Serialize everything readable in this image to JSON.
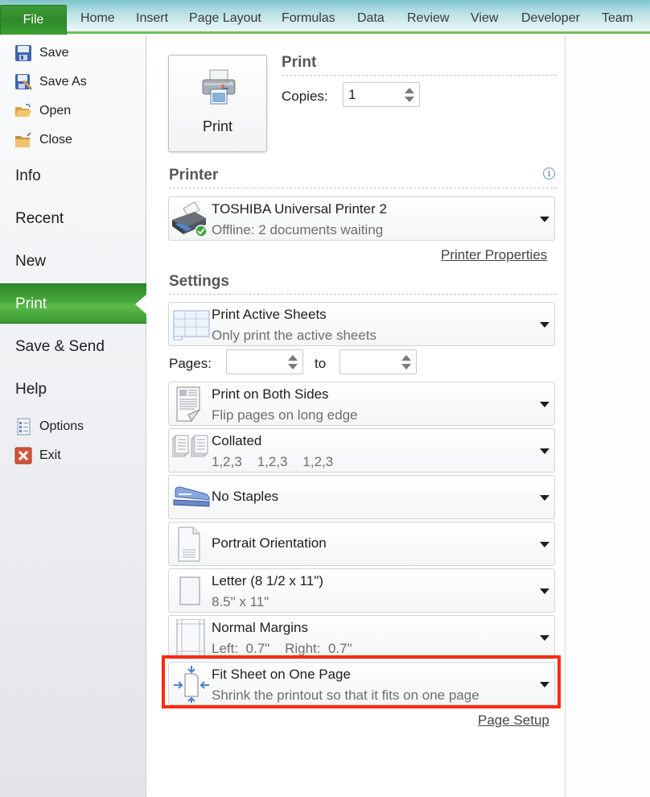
{
  "ribbon": {
    "file_tab": "File",
    "tabs": [
      "Home",
      "Insert",
      "Page Layout",
      "Formulas",
      "Data",
      "Review",
      "View",
      "Developer",
      "Team"
    ]
  },
  "sidebar": {
    "small_items_top": [
      {
        "label": "Save",
        "icon": "save-icon"
      },
      {
        "label": "Save As",
        "icon": "save-as-icon"
      },
      {
        "label": "Open",
        "icon": "open-folder-icon"
      },
      {
        "label": "Close",
        "icon": "close-folder-icon"
      }
    ],
    "big_items": [
      {
        "label": "Info",
        "active": false
      },
      {
        "label": "Recent",
        "active": false
      },
      {
        "label": "New",
        "active": false
      },
      {
        "label": "Print",
        "active": true
      },
      {
        "label": "Save & Send",
        "active": false
      },
      {
        "label": "Help",
        "active": false
      }
    ],
    "small_items_bottom": [
      {
        "label": "Options",
        "icon": "options-icon"
      },
      {
        "label": "Exit",
        "icon": "exit-icon"
      }
    ]
  },
  "print": {
    "button_label": "Print",
    "section_title": "Print",
    "copies_label": "Copies:",
    "copies_value": "1"
  },
  "printer": {
    "section_title": "Printer",
    "name": "TOSHIBA Universal Printer 2",
    "status": "Offline: 2 documents waiting",
    "properties_link": "Printer Properties"
  },
  "settings": {
    "section_title": "Settings",
    "pages_label": "Pages:",
    "pages_to_label": "to",
    "pages_from_value": "",
    "pages_to_value": "",
    "options": [
      {
        "title": "Print Active Sheets",
        "subtitle": "Only print the active sheets",
        "icon": "active-sheets-icon"
      },
      {
        "title": "Print on Both Sides",
        "subtitle": "Flip pages on long edge",
        "icon": "both-sides-icon"
      },
      {
        "title": "Collated",
        "subtitle": "1,2,3    1,2,3    1,2,3",
        "icon": "collated-icon"
      },
      {
        "title": "No Staples",
        "subtitle": "",
        "icon": "stapler-icon"
      },
      {
        "title": "Portrait Orientation",
        "subtitle": "",
        "icon": "portrait-page-icon"
      },
      {
        "title": "Letter (8 1/2 x 11\")",
        "subtitle": "8.5\" x 11\"",
        "icon": "paper-size-icon"
      },
      {
        "title": "Normal Margins",
        "subtitle": "Left:  0.7\"    Right:  0.7\"",
        "icon": "margins-icon"
      },
      {
        "title": "Fit Sheet on One Page",
        "subtitle": "Shrink the printout so that it fits on one page",
        "icon": "fit-to-page-icon"
      }
    ],
    "page_setup_link": "Page Setup"
  },
  "colors": {
    "accent_green": "#3a9a32",
    "highlight_red": "#ff2a12"
  }
}
